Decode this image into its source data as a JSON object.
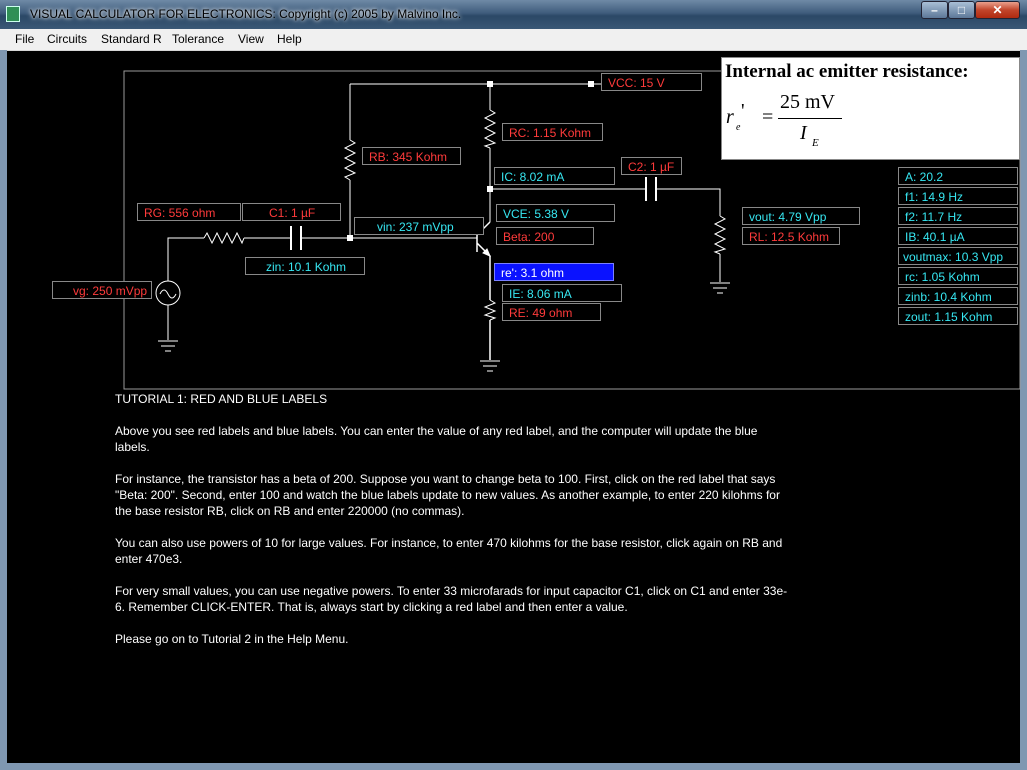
{
  "window": {
    "title": "VISUAL CALCULATOR FOR ELECTRONICS:  Copyright (c) 2005 by Malvino Inc.",
    "min_glyph": "–",
    "max_glyph": "□",
    "close_glyph": "✕"
  },
  "menu": [
    "File",
    "Circuits",
    "Standard R",
    "Tolerance",
    "View",
    "Help"
  ],
  "circuit": {
    "vcc": "VCC: 15 V",
    "rc": "RC: 1.15 Kohm",
    "rb": "RB: 345 Kohm",
    "ic": "IC: 8.02 mA",
    "c2": "C2: 1 µF",
    "rg": "RG: 556 ohm",
    "c1": "C1: 1 µF",
    "vin": "vin: 237 mVpp",
    "vce": "VCE: 5.38 V",
    "vout": "vout: 4.79 Vpp",
    "beta": "Beta: 200",
    "rl": "RL: 12.5 Kohm",
    "zin": "zin: 10.1 Kohm",
    "re_prime": "re': 3.1 ohm",
    "vg": "vg: 250 mVpp",
    "ie": "IE: 8.06 mA",
    "re": "RE: 49 ohm"
  },
  "results": [
    "A: 20.2",
    "f1: 14.9 Hz",
    "f2: 11.7 Hz",
    "IB: 40.1 µA",
    "voutmax: 10.3 Vpp",
    "rc: 1.05 Kohm",
    "zinb: 10.4 Kohm",
    "zout: 1.15 Kohm"
  ],
  "formula": {
    "title": "Internal ac emitter resistance:",
    "lhs": "r",
    "lhs_sub": "e",
    "prime": "'",
    "eq": "=",
    "numerator": "25 mV",
    "denominator": "I",
    "denominator_sub": "E"
  },
  "tutorial": {
    "title": "TUTORIAL 1: RED AND BLUE LABELS",
    "paragraphs": [
      "Above you see red labels and blue labels. You can enter the value of any red label, and the computer will update the blue labels.",
      "For instance, the transistor has a beta of 200. Suppose you want to change beta to 100. First, click on the red label that says \"Beta: 200\". Second, enter 100 and watch the blue labels update to new values. As another example, to enter 220 kilohms for the base resistor RB, click on RB and enter 220000 (no commas).",
      "You can also use powers of 10 for large values. For instance, to enter 470 kilohms for the base resistor, click again on RB and enter 470e3.",
      "For very small values, you can use negative powers. To enter 33 microfarads for input capacitor C1, click on C1 and enter 33e-6. Remember CLICK-ENTER. That is, always start by clicking a red label and then enter a value.",
      "Please go on to Tutorial 2 in the Help Menu."
    ]
  },
  "colors": {
    "input_label": "#ff3b3b",
    "output_label": "#37e7f2",
    "selected_label": "#0a12ff",
    "background": "#000000"
  }
}
